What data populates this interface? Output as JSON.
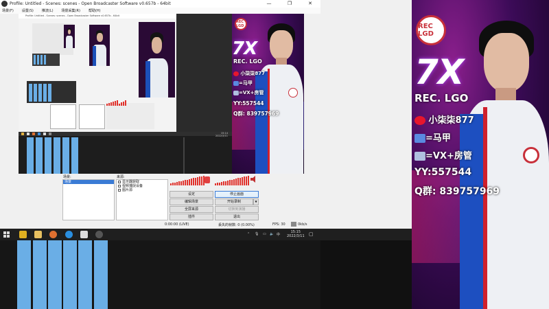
{
  "window": {
    "title": "Profile: Untitled - Scenes: scenes - Open Broadcaster Software v0.657b - 64bit",
    "controls": [
      "—",
      "❐",
      "✕"
    ]
  },
  "menu": [
    "场景(F)",
    "设置(S)",
    "推流(L)",
    "场景采集(R)",
    "帮助(H)"
  ],
  "inner_title": "Profile: Untitled - Scenes: scenes - Open Broadcaster Software v0.657b - 64bit",
  "inner_clock": [
    "15:14",
    "2022/3/11"
  ],
  "poster": {
    "big_text": "7X",
    "team": "REC. LGO",
    "logo_text": "REC LGD",
    "lines": [
      "小柒柒877",
      "=马甲",
      "=VX+房管",
      "YY:557544",
      "Q群: 839757969"
    ]
  },
  "scenes": {
    "label": "场景:",
    "items": [
      "场景"
    ]
  },
  "sources": {
    "label": "来源:",
    "items": [
      "显示器获取",
      "视频捕捉设备",
      "图片源"
    ]
  },
  "buttons": {
    "settings": "设定",
    "stop_preview": "停止画面",
    "edit_scene": "编辑场景",
    "start_record": "开始录制",
    "fullscreen": "全屏来源",
    "studio_mode": "切换到演播",
    "plugins": "插件",
    "exit": "退出",
    "dropdown": "▼"
  },
  "status": {
    "time": "0:00:00 (LIVE)",
    "dropped": "丢失的帧数: 0 (0.00%)",
    "fps": "FPS: 30",
    "kbps": "0kb/s"
  },
  "taskbar": {
    "tray_lang": "中",
    "tray_time": "15:15",
    "tray_date": "2022/3/11"
  },
  "colors": {
    "accent": "#3a7bd5",
    "meter_red": "#e0302a",
    "bar_blue": "#6aaee6"
  }
}
